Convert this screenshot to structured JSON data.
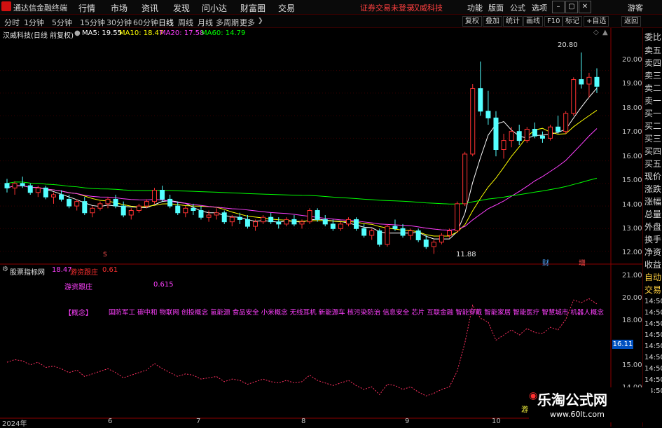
{
  "menubar": {
    "app_title": "通达信金融终端",
    "items": [
      "行情",
      "市场",
      "资讯",
      "发现",
      "问小达",
      "财富圈",
      "交易"
    ],
    "center_note": "证券交易未登录",
    "center_stock": "汉威科技",
    "right_items": [
      "功能",
      "版面",
      "公式",
      "选项"
    ],
    "user": "游客"
  },
  "toolbar": {
    "periods": [
      "分时",
      "1分钟",
      "5分钟",
      "15分钟",
      "30分钟",
      "60分钟",
      "日线",
      "周线",
      "月线",
      "多周期",
      "更多"
    ],
    "active_period": "日线",
    "buttons": [
      "复权",
      "叠加",
      "统计",
      "画线",
      "F10",
      "标记",
      "+自选",
      "返回"
    ]
  },
  "infobar": {
    "stock": "汉威科技(日线 前复权)",
    "ma5": "MA5: 19.55",
    "ma10": "MA10: 18.47",
    "ma20": "MA20: 17.58",
    "ma60": "MA60: 14.79",
    "colors": {
      "ma5": "#ffffff",
      "ma10": "#ffff00",
      "ma20": "#ff40ff",
      "ma60": "#00ff00"
    }
  },
  "price_axis": [
    "20.00",
    "19.00",
    "18.00",
    "17.00",
    "16.00",
    "15.00",
    "14.00",
    "13.00",
    "12.00"
  ],
  "annotations": {
    "high": "20.80",
    "low": "11.88",
    "tag_cai": "财",
    "tag_zeng": "增"
  },
  "indicator": {
    "title": "股票指标网",
    "v1": "18.47",
    "label": "游资跟庄",
    "v2": "0.61",
    "line2_label": "游资跟庄",
    "line2_value": "0.615",
    "concepts_head": "【概念】",
    "concepts": "国防军工 碳中和 物联网 创投概念 氢能源 食品安全 小米概念 无线耳机 新能源车 核污染防治 信息安全 芯片 互联金融 智能穿戴 智能家居 智能医疗 智慧城市 机器人概念",
    "axis": [
      "21.00",
      "20.00",
      "19.00",
      "18.00",
      "17.00",
      "16.00",
      "15.00",
      "14.00"
    ],
    "current": "16.11",
    "marker": "游"
  },
  "date_axis": [
    "2024年",
    "6",
    "7",
    "8",
    "9",
    "10"
  ],
  "right_panel": {
    "top": [
      "委比",
      "卖五",
      "卖四",
      "卖三",
      "卖二",
      "卖一",
      "买一",
      "买二",
      "买三",
      "买四",
      "买五",
      "现价",
      "涨跌",
      "涨幅",
      "总量",
      "外盘",
      "换手",
      "净资",
      "收益"
    ],
    "bottom": [
      "自动",
      "交易",
      "14:50",
      "14:50",
      "14:50",
      "14:50",
      "14:50",
      "14:50",
      "14:50",
      "14:50",
      "14:50",
      "14:50"
    ]
  },
  "watermark": {
    "title": "乐淘公式网",
    "url": "www.60lt.com"
  },
  "chart_data": {
    "type": "candlestick",
    "y_range": [
      11.8,
      21.2
    ],
    "candles": [
      [
        15.0,
        15.2,
        14.6,
        14.8
      ],
      [
        14.8,
        15.1,
        14.5,
        15.0
      ],
      [
        15.0,
        15.3,
        14.8,
        14.9
      ],
      [
        14.9,
        15.0,
        14.5,
        14.6
      ],
      [
        14.6,
        14.9,
        14.4,
        14.8
      ],
      [
        14.8,
        14.9,
        14.3,
        14.4
      ],
      [
        14.4,
        14.6,
        14.1,
        14.5
      ],
      [
        14.5,
        14.7,
        14.2,
        14.3
      ],
      [
        14.3,
        14.5,
        13.9,
        14.0
      ],
      [
        14.0,
        14.3,
        13.8,
        14.2
      ],
      [
        14.2,
        14.4,
        13.6,
        13.7
      ],
      [
        13.7,
        14.0,
        13.5,
        13.9
      ],
      [
        13.9,
        14.2,
        13.8,
        14.1
      ],
      [
        14.1,
        14.4,
        13.9,
        14.3
      ],
      [
        14.3,
        14.5,
        13.9,
        14.0
      ],
      [
        14.0,
        14.2,
        13.5,
        13.6
      ],
      [
        13.6,
        13.9,
        13.4,
        13.8
      ],
      [
        13.8,
        14.1,
        13.7,
        14.0
      ],
      [
        14.0,
        14.3,
        13.9,
        14.2
      ],
      [
        14.2,
        14.8,
        14.1,
        14.7
      ],
      [
        14.7,
        14.9,
        14.2,
        14.3
      ],
      [
        14.3,
        14.5,
        13.9,
        14.0
      ],
      [
        14.0,
        14.2,
        13.6,
        13.7
      ],
      [
        13.7,
        14.0,
        13.5,
        13.9
      ],
      [
        13.9,
        14.1,
        13.6,
        13.8
      ],
      [
        13.8,
        14.0,
        13.4,
        13.5
      ],
      [
        13.5,
        13.8,
        13.3,
        13.6
      ],
      [
        13.6,
        13.9,
        13.4,
        13.7
      ],
      [
        13.7,
        13.8,
        13.2,
        13.3
      ],
      [
        13.3,
        13.6,
        13.1,
        13.5
      ],
      [
        13.5,
        13.7,
        13.2,
        13.4
      ],
      [
        13.4,
        13.6,
        13.0,
        13.1
      ],
      [
        13.1,
        13.4,
        12.9,
        13.3
      ],
      [
        13.3,
        13.6,
        13.2,
        13.5
      ],
      [
        13.5,
        13.7,
        13.2,
        13.3
      ],
      [
        13.3,
        13.5,
        13.0,
        13.2
      ],
      [
        13.2,
        13.5,
        13.1,
        13.4
      ],
      [
        13.4,
        13.6,
        13.1,
        13.2
      ],
      [
        13.2,
        13.4,
        13.0,
        13.3
      ],
      [
        13.3,
        13.9,
        13.2,
        13.8
      ],
      [
        13.8,
        13.9,
        13.3,
        13.4
      ],
      [
        13.4,
        13.6,
        13.1,
        13.2
      ],
      [
        13.2,
        13.4,
        12.9,
        13.0
      ],
      [
        13.0,
        13.3,
        12.9,
        13.2
      ],
      [
        13.2,
        13.5,
        13.1,
        13.4
      ],
      [
        13.4,
        13.5,
        12.9,
        13.0
      ],
      [
        13.0,
        13.2,
        12.6,
        12.7
      ],
      [
        12.7,
        13.0,
        12.5,
        12.9
      ],
      [
        12.9,
        13.0,
        12.2,
        12.3
      ],
      [
        12.3,
        13.2,
        12.2,
        13.1
      ],
      [
        13.1,
        13.4,
        12.9,
        13.0
      ],
      [
        13.0,
        13.2,
        12.6,
        12.7
      ],
      [
        12.7,
        13.0,
        12.5,
        12.9
      ],
      [
        12.9,
        13.0,
        12.4,
        12.5
      ],
      [
        12.5,
        12.7,
        12.1,
        12.2
      ],
      [
        12.2,
        12.5,
        11.88,
        12.4
      ],
      [
        12.4,
        12.8,
        12.3,
        12.7
      ],
      [
        12.7,
        13.0,
        12.6,
        12.9
      ],
      [
        12.9,
        14.2,
        12.8,
        14.1
      ],
      [
        14.1,
        16.4,
        14.0,
        16.3
      ],
      [
        16.3,
        19.4,
        16.2,
        19.2
      ],
      [
        19.2,
        20.4,
        18.0,
        18.2
      ],
      [
        18.2,
        19.1,
        17.6,
        17.9
      ],
      [
        17.9,
        18.2,
        16.2,
        16.5
      ],
      [
        16.5,
        17.2,
        16.1,
        16.9
      ],
      [
        16.9,
        17.5,
        16.6,
        17.3
      ],
      [
        17.3,
        17.6,
        16.7,
        16.9
      ],
      [
        16.9,
        17.5,
        16.8,
        17.4
      ],
      [
        17.4,
        17.7,
        17.0,
        17.1
      ],
      [
        17.1,
        17.3,
        16.8,
        17.0
      ],
      [
        17.0,
        17.6,
        16.9,
        17.5
      ],
      [
        17.5,
        18.0,
        17.2,
        17.3
      ],
      [
        17.3,
        18.2,
        17.2,
        18.1
      ],
      [
        18.1,
        19.7,
        18.0,
        19.6
      ],
      [
        19.6,
        20.8,
        19.2,
        19.4
      ],
      [
        19.4,
        19.9,
        18.8,
        19.7
      ],
      [
        19.7,
        20.1,
        19.0,
        19.3
      ]
    ]
  }
}
